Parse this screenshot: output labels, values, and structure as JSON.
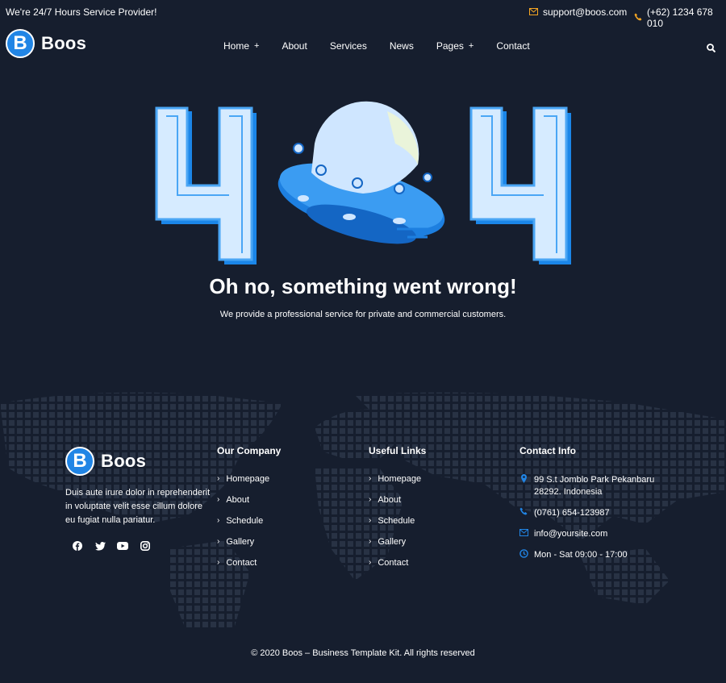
{
  "topbar": {
    "tagline": "We're 24/7 Hours Service Provider!",
    "email": "support@boos.com",
    "phone": "(+62) 1234 678 010"
  },
  "brand": {
    "letter": "B",
    "name": "Boos"
  },
  "nav": {
    "items": [
      {
        "label": "Home",
        "plus": true
      },
      {
        "label": "About",
        "plus": false
      },
      {
        "label": "Services",
        "plus": false
      },
      {
        "label": "News",
        "plus": false
      },
      {
        "label": "Pages",
        "plus": true
      },
      {
        "label": "Contact",
        "plus": false
      }
    ],
    "plus_symbol": "+"
  },
  "hero": {
    "headline": "Oh no, something went wrong!",
    "subline": "We provide a professional service for private and commercial customers."
  },
  "footer": {
    "about": "Duis aute irure dolor in reprehenderit in voluptate velit esse cillum dolore eu fugiat nulla pariatur.",
    "social_icons": [
      "facebook-icon",
      "twitter-icon",
      "youtube-icon",
      "instagram-icon"
    ],
    "company": {
      "title": "Our Company",
      "links": [
        "Homepage",
        "About",
        "Schedule",
        "Gallery",
        "Contact"
      ]
    },
    "useful": {
      "title": "Useful Links",
      "links": [
        "Homepage",
        "About",
        "Schedule",
        "Gallery",
        "Contact"
      ]
    },
    "contact": {
      "title": "Contact Info",
      "address_line1": "99 S.t Jomblo Park Pekanbaru",
      "address_line2": "28292. Indonesia",
      "phone": "(0761) 654-123987",
      "email": "info@yoursite.com",
      "hours": "Mon - Sat 09:00 - 17:00"
    },
    "copyright": "© 2020 Boos – Business Template Kit. All rights reserved"
  },
  "colors": {
    "background": "#161e2e",
    "accent": "#2185e5",
    "highlight": "#f5a623"
  }
}
